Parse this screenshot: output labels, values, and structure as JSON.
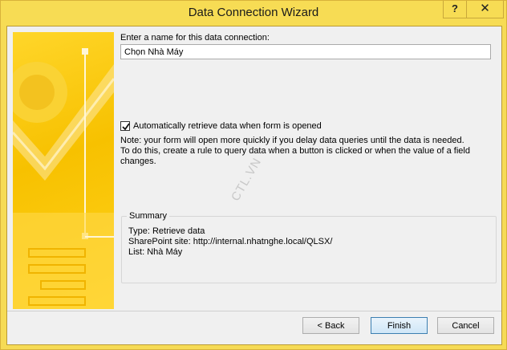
{
  "window": {
    "title": "Data Connection Wizard",
    "help_glyph": "?",
    "close_glyph": "✕"
  },
  "form": {
    "name_label": "Enter a name for this data connection:",
    "name_value": "Chọn Nhà Máy",
    "auto_retrieve_checked": true,
    "auto_retrieve_label": "Automatically retrieve data when form is opened",
    "note_lines": [
      "Note: your form will open more quickly if you delay data queries until the data is needed.",
      "To do this, create a rule to query data when a button is clicked or when the value of a field",
      "changes."
    ]
  },
  "summary": {
    "title": "Summary",
    "lines": [
      "Type: Retrieve data",
      "SharePoint site: http://internal.nhatnghe.local/QLSX/",
      "List: Nhà Máy"
    ]
  },
  "buttons": {
    "back": "< Back",
    "finish": "Finish",
    "cancel": "Cancel"
  },
  "watermark": "CTL.VN",
  "colors": {
    "title_bar": "#f7dc54",
    "banner": "#f7c100",
    "client_bg": "#f0f0f0"
  }
}
